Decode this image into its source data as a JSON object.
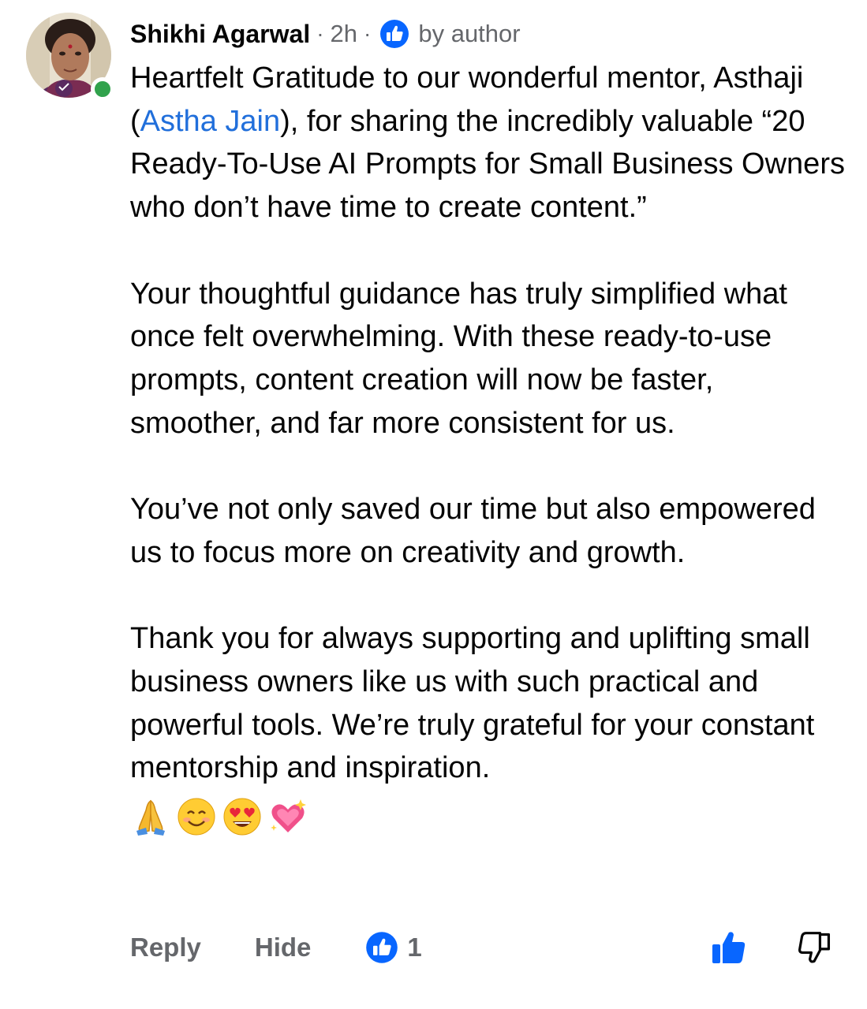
{
  "comment": {
    "author": "Shikhi Agarwal",
    "separator_1": "·",
    "time": "2h",
    "separator_2": "·",
    "badge_label": "by author",
    "paragraphs": [
      {
        "parts": [
          {
            "text": "Heartfelt Gratitude to our wonderful mentor, Asthaji (",
            "mention": false
          },
          {
            "text": "Astha Jain",
            "mention": true
          },
          {
            "text": "), for sharing the incredibly valuable “20 Ready-To-Use AI Prompts for Small Business Owners who don’t have time to create content.”",
            "mention": false
          }
        ]
      },
      {
        "parts": [
          {
            "text": "Your thoughtful guidance has truly simplified what once felt overwhelming. With these ready-to-use prompts, content creation will now be faster, smoother, and far more consistent for us.",
            "mention": false
          }
        ]
      },
      {
        "parts": [
          {
            "text": "You’ve not only saved our time but also empowered us to focus more on creativity and growth.",
            "mention": false
          }
        ]
      },
      {
        "parts": [
          {
            "text": "Thank you for always supporting and uplifting small business owners like us with such practical and powerful tools. We’re truly grateful for your constant mentorship and inspiration.",
            "mention": false
          }
        ]
      }
    ],
    "emojis": [
      "folded-hands-emoji",
      "smiling-face-emoji",
      "heart-eyes-emoji",
      "sparkling-heart-emoji"
    ]
  },
  "actions": {
    "reply_label": "Reply",
    "hide_label": "Hide",
    "reaction_count": "1",
    "reaction_type": "like"
  },
  "colors": {
    "text": "#050505",
    "secondary": "#65676b",
    "mention": "#216fdb",
    "like_blue": "#0866ff",
    "online_green": "#31a24c"
  }
}
